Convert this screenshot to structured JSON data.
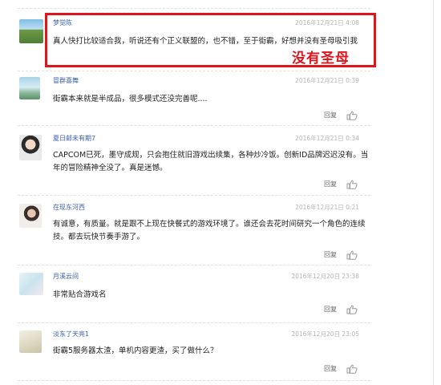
{
  "comments": [
    {
      "user": "梦觉陈",
      "time": "2016年12月21日 4:08",
      "text": "真人快打比较适合我，听说还有个正义联盟的，也不错，至于街霸，好想并没有圣母吸引我"
    },
    {
      "user": "冒群喜舞",
      "time": "2016年12月21日 0:39",
      "text": "街霸本来就是半成品，很多模式还没完善呢....",
      "reply": "回复"
    },
    {
      "user": "夏日邮未有期7",
      "time": "2016年12月21日 0:34",
      "text": "CAPCOM已死，墨守成规，只会抱住就旧游戏出续集，各种炒冷饭。创新ID品牌迟迟没有。当年的冒险精神全没了。真是迷憾。",
      "reply": "回复"
    },
    {
      "user": "在现东河西",
      "time": "2016年12月21日 0:21",
      "text": "有诚意，有质量。就是跟不上现在快餐式的游戏环境了。谁还会去花时间研究一个角色的连续技。都去玩快节奏手游了。",
      "reply": "回复"
    },
    {
      "user": "月溪云间",
      "time": "2016年12月20日 23:38",
      "text": "非常贴合游戏名",
      "reply": "回复"
    },
    {
      "user": "淡东了天亮1",
      "time": "2016年12月20日 23:05",
      "text": "街霸5服务器太渣，单机内容更渣，买了做什么？",
      "reply": "回复"
    }
  ],
  "annotation": {
    "text": "没有圣母",
    "color": "#e0141c"
  },
  "colors": {
    "username": "#3a5eb0",
    "timestamp": "#b5b5b5",
    "body": "#222222"
  }
}
